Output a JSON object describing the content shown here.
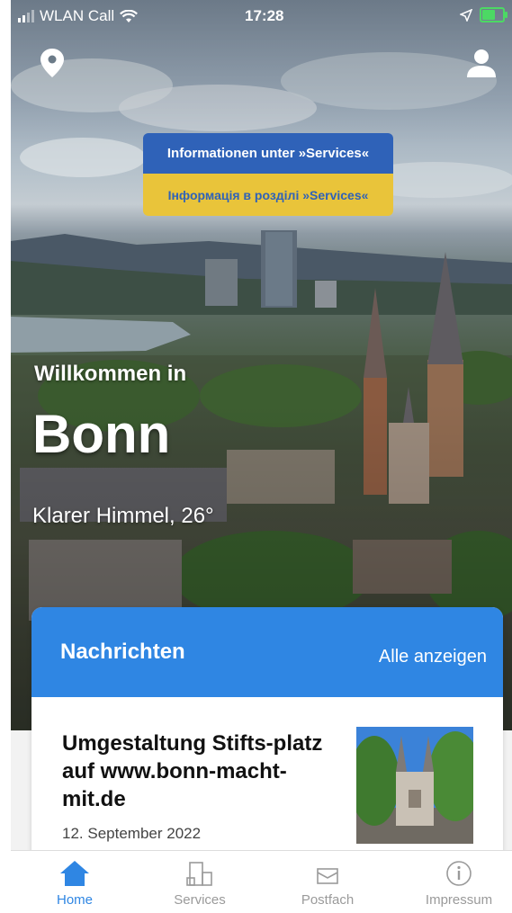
{
  "status_bar": {
    "carrier": "WLAN Call",
    "time": "17:28"
  },
  "banner": {
    "line_de": "Informationen unter »Services«",
    "line_uk": "Інформація в розділі »Services«",
    "colors": {
      "blue": "#2f62b8",
      "yellow": "#e9c43a"
    }
  },
  "hero": {
    "welcome": "Willkommen in",
    "city": "Bonn",
    "weather": "Klarer Himmel, 26°"
  },
  "news": {
    "title": "Nachrichten",
    "show_all": "Alle anzeigen",
    "article": {
      "title": "Umgestaltung Stifts-platz auf www.bonn-macht-mit.de",
      "date": "12. September 2022"
    }
  },
  "tabbar": {
    "tabs": [
      {
        "label": "Home",
        "icon": "home-icon",
        "active": true
      },
      {
        "label": "Services",
        "icon": "services-icon",
        "active": false
      },
      {
        "label": "Postfach",
        "icon": "mailbox-icon",
        "active": false
      },
      {
        "label": "Impressum",
        "icon": "info-icon",
        "active": false
      }
    ]
  },
  "colors": {
    "accent": "#2f86e3",
    "inactive": "#9a9a9a"
  }
}
